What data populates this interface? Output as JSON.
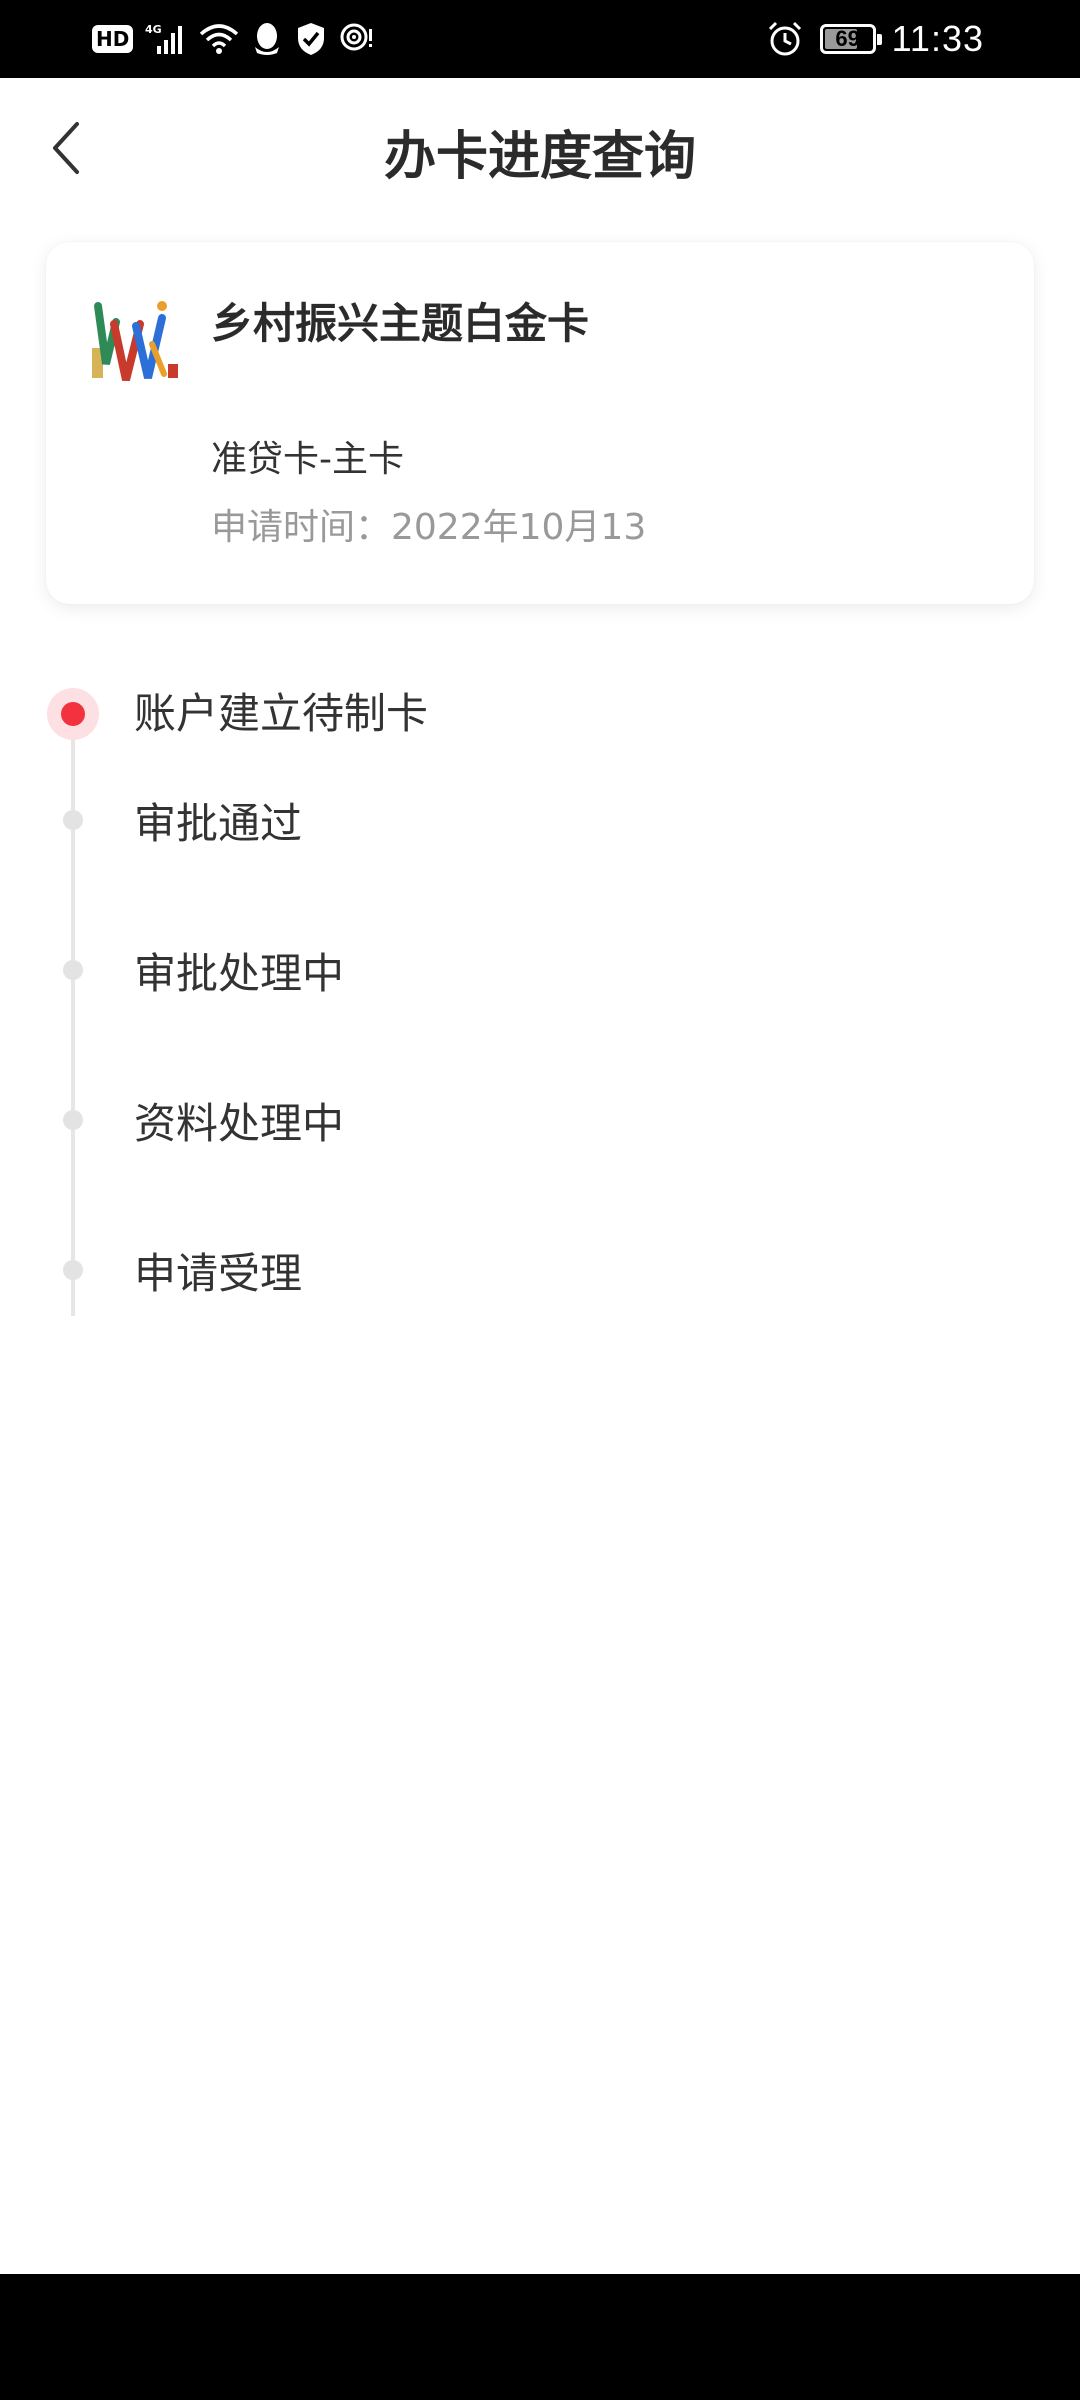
{
  "status_bar": {
    "hd_label": "HD",
    "network_label": "4G",
    "battery_level": 69,
    "battery_label": "69",
    "time": "11:33",
    "icons": [
      "signal-icon",
      "wifi-icon",
      "qq-icon",
      "shield-icon",
      "hotspot-icon",
      "alarm-icon",
      "battery-icon"
    ]
  },
  "nav": {
    "title": "办卡进度查询",
    "back_icon": "chevron-left-icon"
  },
  "card": {
    "name": "乡村振兴主题白金卡",
    "type": "准贷卡-主卡",
    "apply_time": "申请时间：2022年10月13"
  },
  "timeline": {
    "steps": [
      {
        "label": "账户建立待制卡",
        "active": true
      },
      {
        "label": "审批通过",
        "active": false
      },
      {
        "label": "审批处理中",
        "active": false
      },
      {
        "label": "资料处理中",
        "active": false
      },
      {
        "label": "申请受理",
        "active": false
      }
    ]
  },
  "colors": {
    "accent_red": "#f2323f",
    "accent_red_halo": "#fde0e3",
    "text_primary": "#2b2b2b",
    "text_secondary": "#999999",
    "timeline_gray": "#e3e3e3"
  }
}
